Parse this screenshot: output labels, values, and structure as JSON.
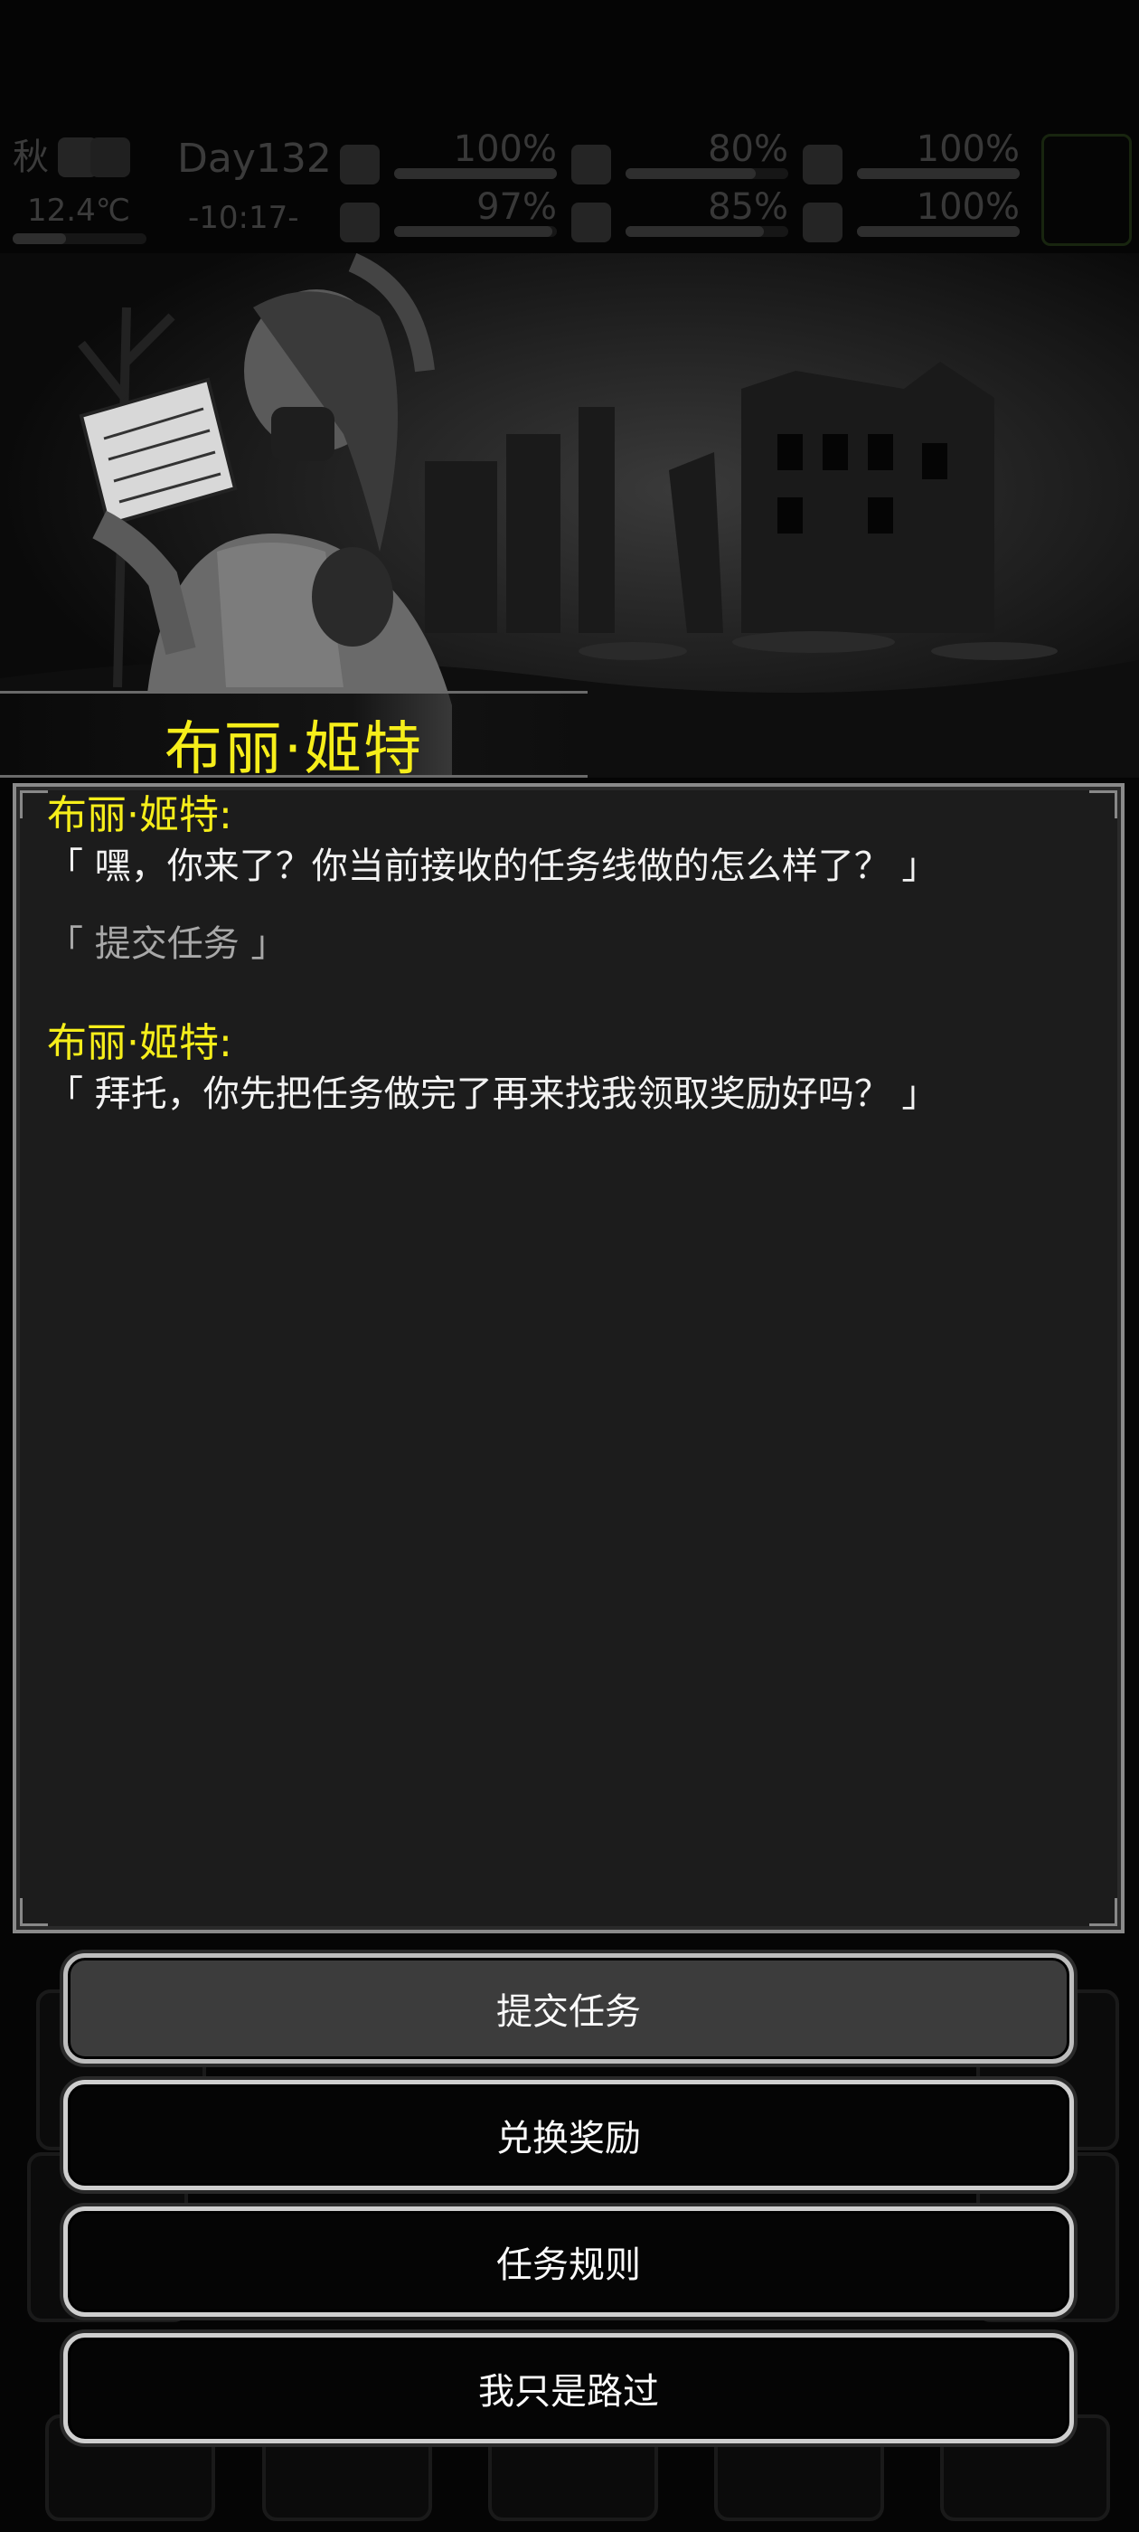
{
  "hud": {
    "season": "秋",
    "temperature": "12.4℃",
    "day": "Day132",
    "time": "-10:17-",
    "stats": [
      {
        "icon": "medkit-icon",
        "value": "100%",
        "level": 1.0
      },
      {
        "icon": "stomach-icon",
        "value": "80%",
        "level": 0.8
      },
      {
        "icon": "mask-icon",
        "value": "100%",
        "level": 1.0
      },
      {
        "icon": "flask-icon",
        "value": "97%",
        "level": 0.97
      },
      {
        "icon": "water-drop-icon",
        "value": "85%",
        "level": 0.85
      },
      {
        "icon": "heart-icon",
        "value": "100%",
        "level": 1.0
      }
    ]
  },
  "npc": {
    "name": "布丽·姬特"
  },
  "dialog": {
    "messages": [
      {
        "speaker": "布丽·姬特:",
        "text": "「 嘿，你来了？你当前接收的任务线做的怎么样了？ 」"
      },
      {
        "choice": "「 提交任务 」"
      },
      {
        "speaker": "布丽·姬特:",
        "text": "「 拜托，你先把任务做完了再来找我领取奖励好吗？ 」"
      }
    ]
  },
  "options": [
    {
      "label": "提交任务"
    },
    {
      "label": "兑换奖励"
    },
    {
      "label": "任务规则"
    },
    {
      "label": "我只是路过"
    }
  ],
  "colors": {
    "speaker": "#f6ee1a",
    "panel": "#1c1c1c",
    "button_border": "#cfcfcf"
  }
}
